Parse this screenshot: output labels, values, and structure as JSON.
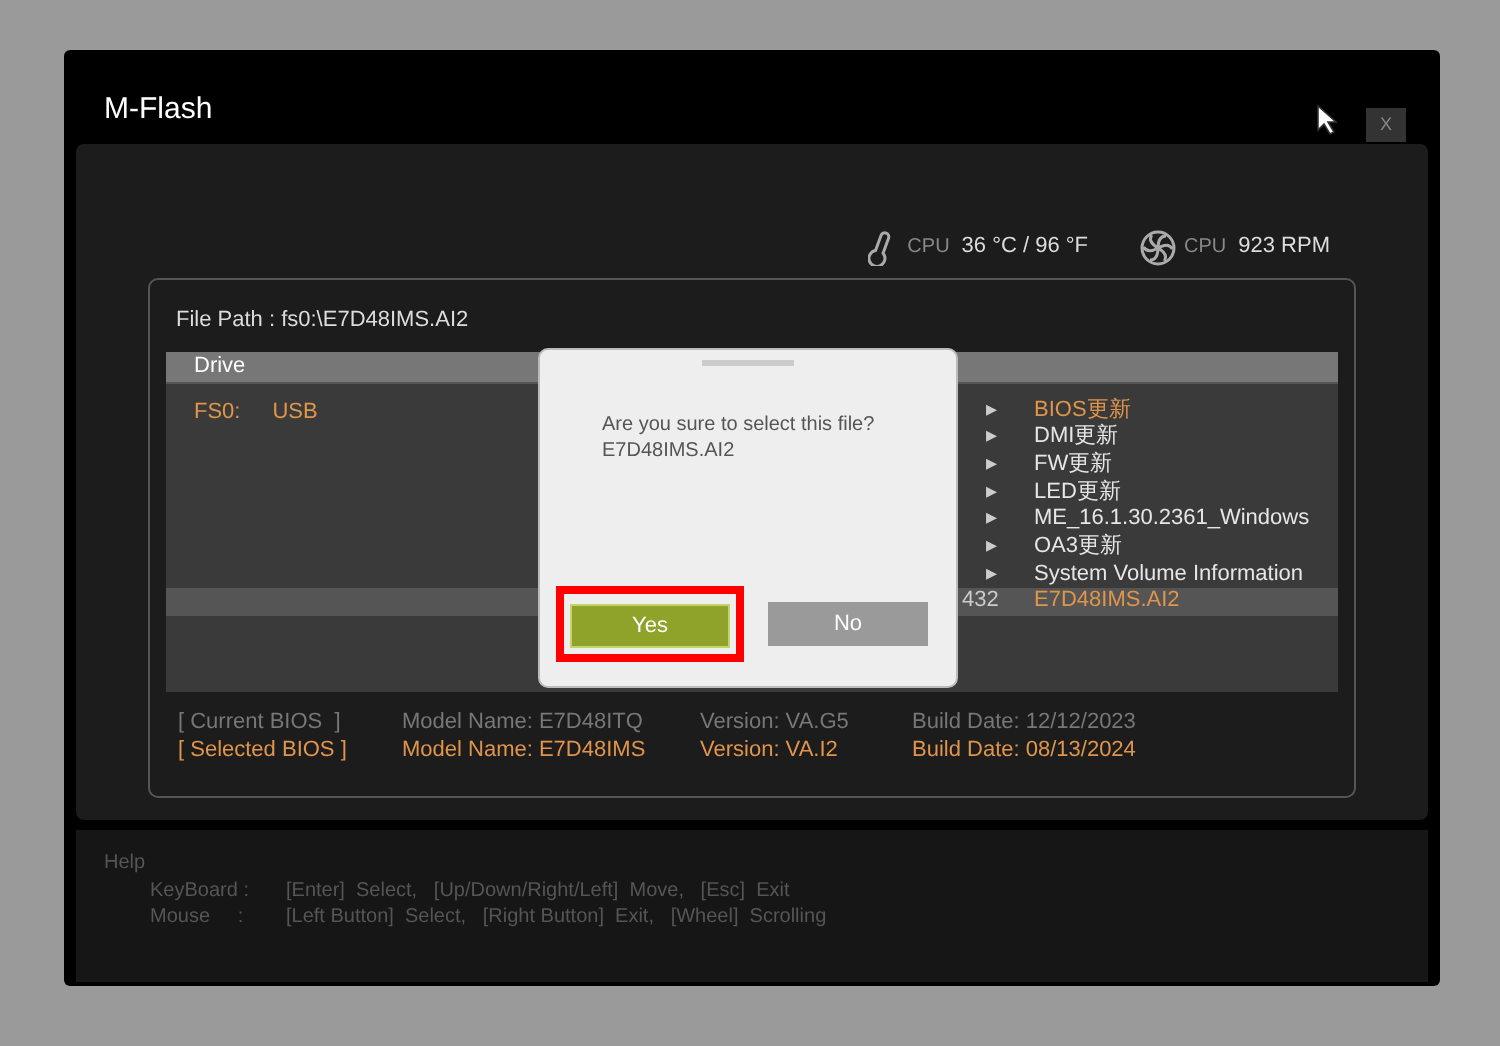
{
  "window": {
    "title": "M-Flash",
    "close_label": "X"
  },
  "sensors": [
    {
      "kind": "temp",
      "label": "CPU",
      "reading": "36 °C / 96 °F"
    },
    {
      "kind": "fan",
      "label": "CPU",
      "reading": "923 RPM"
    }
  ],
  "file_path": "File Path : fs0:\\E7D48IMS.AI2",
  "drive_table": {
    "header": "Drive",
    "drives": [
      {
        "id": "FS0:",
        "type": "USB"
      }
    ]
  },
  "files": [
    {
      "column_1": "▸",
      "name": "BIOS更新",
      "color": "#e0954a",
      "selected": false
    },
    {
      "column_1": "▸",
      "name": "DMI更新",
      "color": "#e6e6e6",
      "selected": false
    },
    {
      "column_1": "▸",
      "name": "FW更新",
      "color": "#e6e6e6",
      "selected": false
    },
    {
      "column_1": "▸",
      "name": "LED更新",
      "color": "#e6e6e6",
      "selected": false
    },
    {
      "column_1": "▸",
      "name": "ME_16.1.30.2361_Windows",
      "color": "#e6e6e6",
      "selected": false
    },
    {
      "column_1": "▸",
      "name": "OA3更新",
      "color": "#e6e6e6",
      "selected": false
    },
    {
      "column_1": "▸",
      "name": "System Volume Information",
      "color": "#e6e6e6",
      "selected": false
    },
    {
      "column_1": "432",
      "name": "E7D48IMS.AI2",
      "color": "#e0954a",
      "selected": true
    }
  ],
  "dialog": {
    "message": "Are you sure to select this file?",
    "filename": "E7D48IMS.AI2",
    "buttons": [
      {
        "label": "Yes",
        "selected": true
      },
      {
        "label": "No",
        "selected": false
      }
    ]
  },
  "bios_info": [
    {
      "kind": "current",
      "label": "[ Current BIOS  ]",
      "model": "Model Name: E7D48ITQ",
      "version": "Version: VA.G5",
      "build_date": "Build Date: 12/12/2023"
    },
    {
      "kind": "selected",
      "label": "[ Selected BIOS ]",
      "model": "Model Name: E7D48IMS",
      "version": "Version: VA.I2",
      "build_date": "Build Date: 08/13/2024"
    }
  ],
  "help": {
    "title": "Help",
    "lines": [
      {
        "label": "KeyBoard :",
        "text": "[Enter]  Select,   [Up/Down/Right/Left]  Move,   [Esc]  Exit"
      },
      {
        "label": "Mouse     :",
        "text": "[Left Button]  Select,   [Right Button]  Exit,   [Wheel]  Scrolling"
      }
    ]
  }
}
